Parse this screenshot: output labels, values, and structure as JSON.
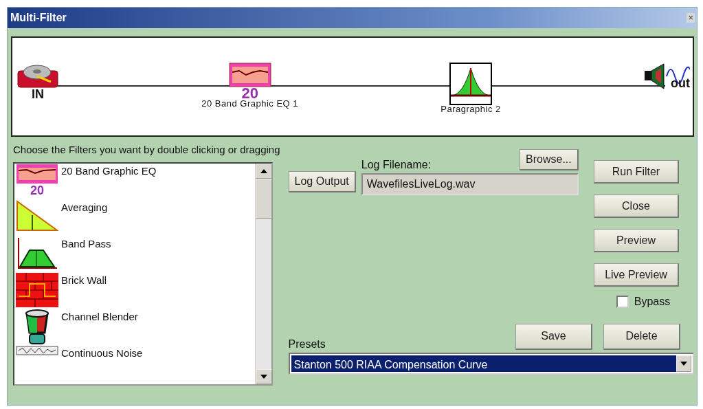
{
  "window": {
    "title": "Multi-Filter",
    "close": "×"
  },
  "chain": [
    {
      "badge": "IN"
    },
    {
      "badge": "20",
      "label": "20 Band Graphic EQ 1"
    },
    {
      "label": "Paragraphic 2"
    },
    {
      "badge": "out"
    }
  ],
  "filters_hint": "Choose the Filters you want by double clicking or dragging",
  "filters": [
    {
      "name": "20 Band Graphic EQ",
      "badge": "20"
    },
    {
      "name": "Averaging"
    },
    {
      "name": "Band Pass"
    },
    {
      "name": "Brick Wall"
    },
    {
      "name": "Channel Blender"
    },
    {
      "name": "Continuous Noise"
    }
  ],
  "log": {
    "button": "Log Output",
    "label": "Log Filename:",
    "value": "WavefilesLiveLog.wav",
    "browse": "Browse..."
  },
  "side_buttons": [
    "Run Filter",
    "Close",
    "Preview",
    "Live Preview"
  ],
  "bypass": {
    "label": "Bypass",
    "checked": false
  },
  "presets": {
    "label": "Presets",
    "value": "Stanton 500 RIAA Compensation Curve",
    "save": "Save",
    "delete": "Delete"
  }
}
